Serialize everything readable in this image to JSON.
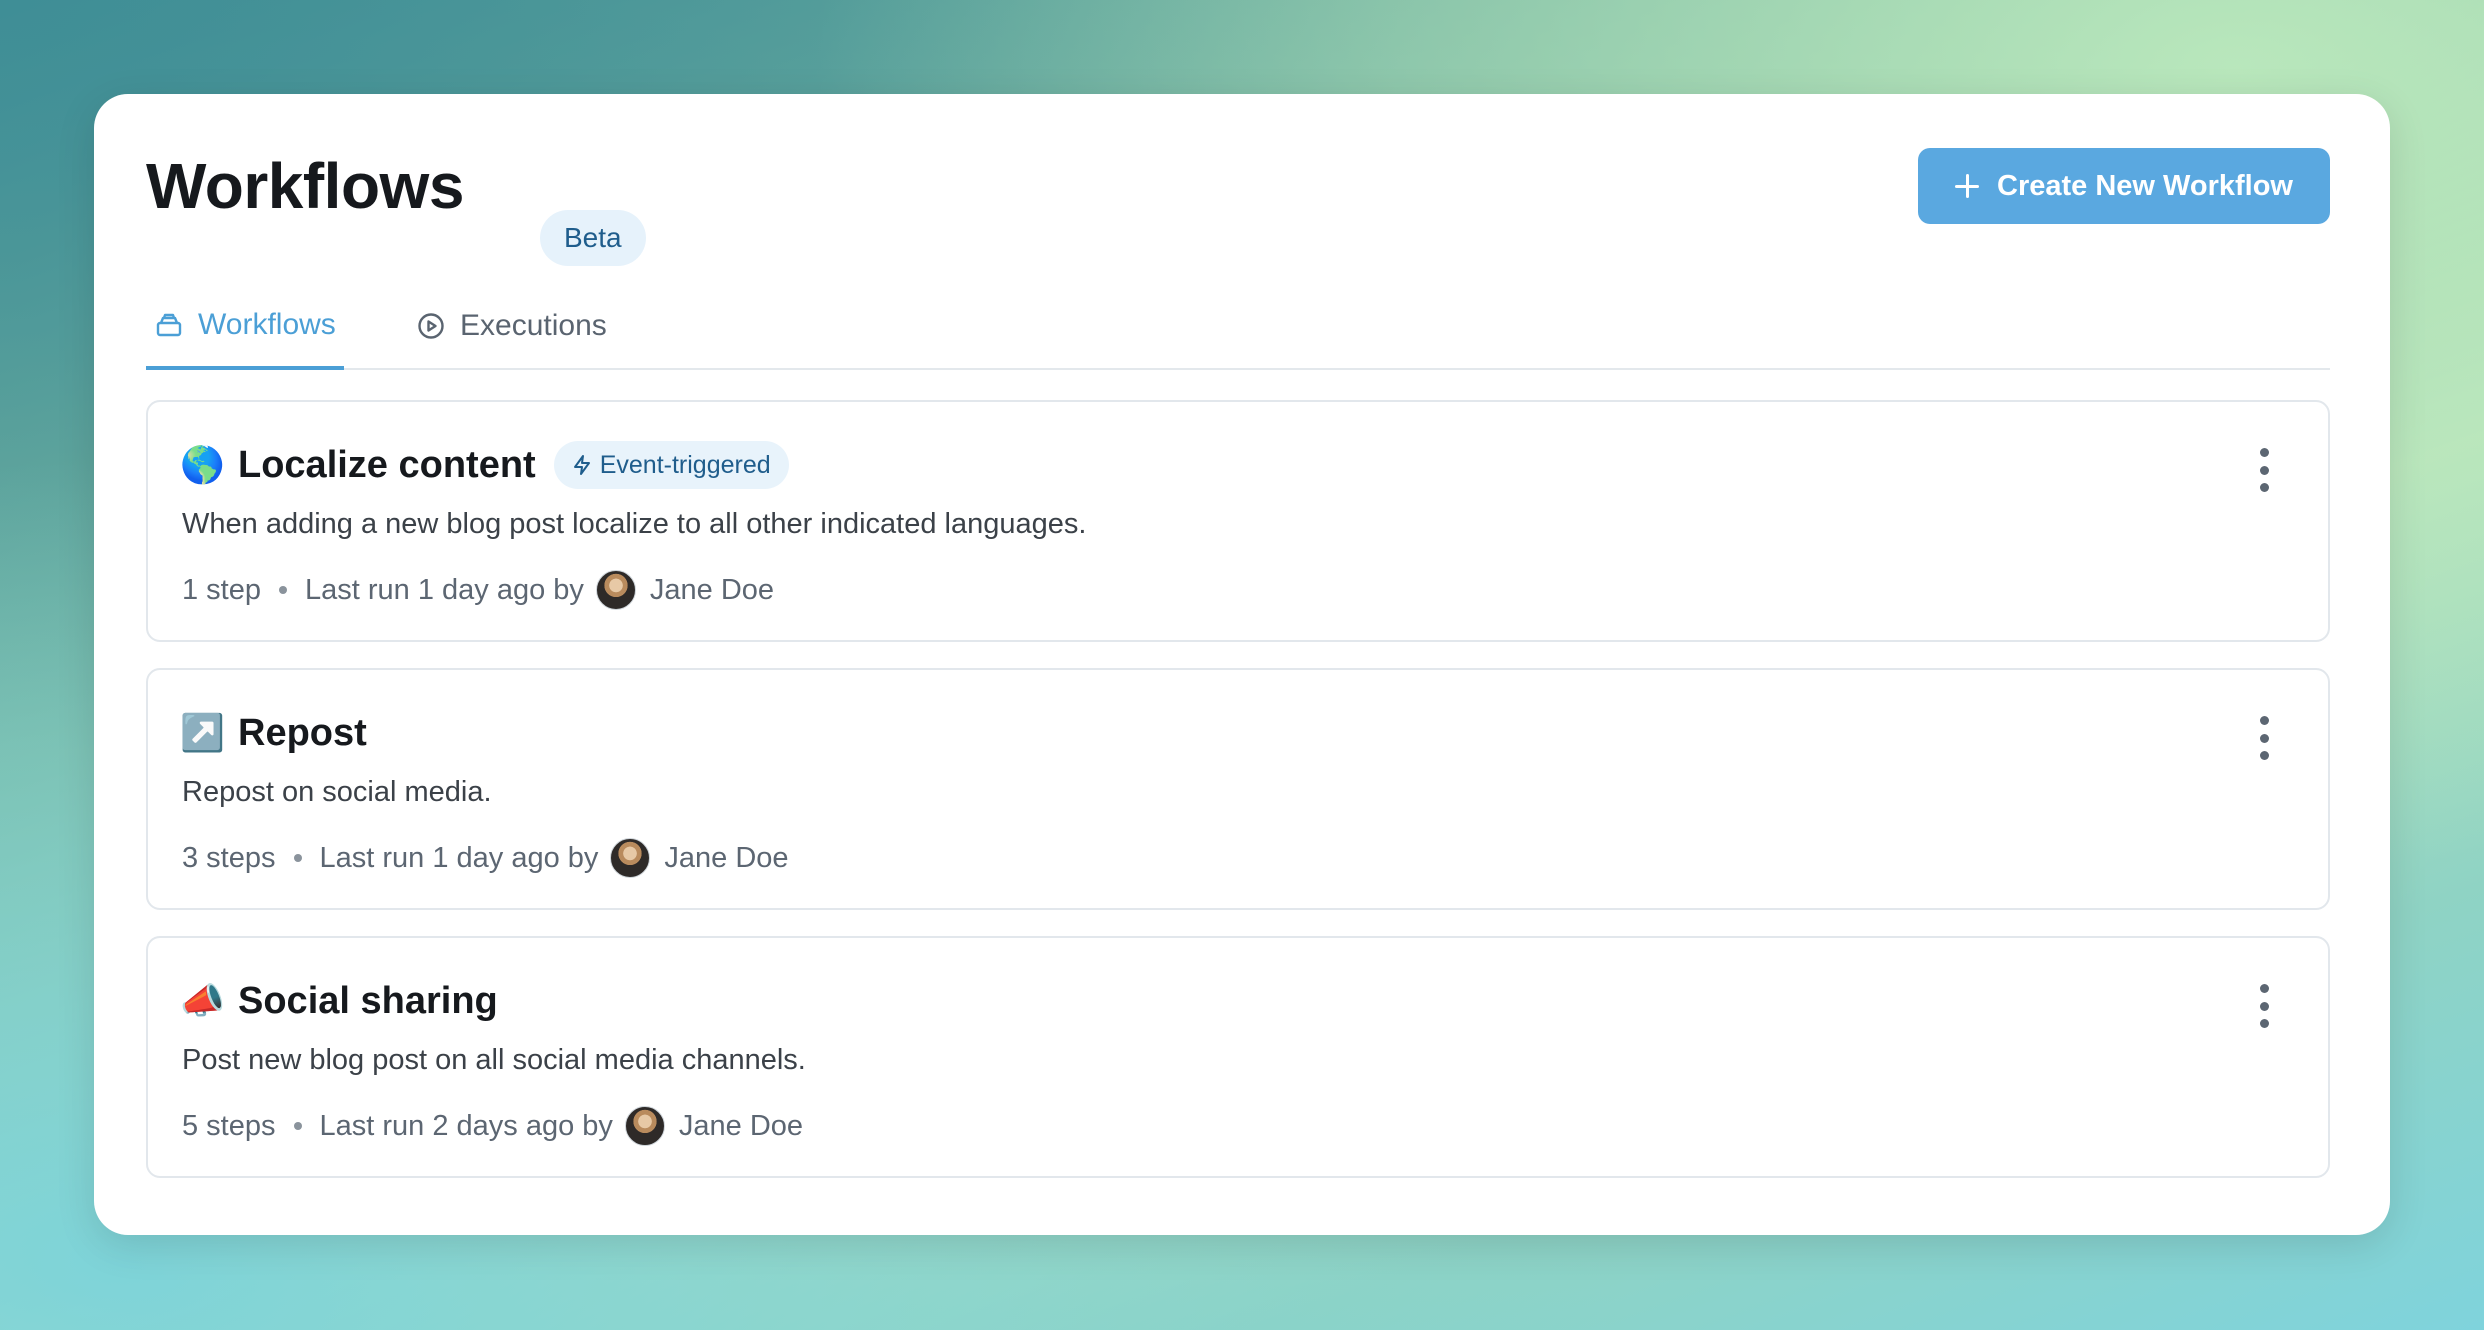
{
  "header": {
    "title": "Workflows",
    "badge": "Beta",
    "create_button_label": "Create New Workflow"
  },
  "tabs": [
    {
      "label": "Workflows",
      "icon": "stack-icon",
      "active": true
    },
    {
      "label": "Executions",
      "icon": "play-circle-icon",
      "active": false
    }
  ],
  "workflows": [
    {
      "emoji": "🌎",
      "title": "Localize content",
      "trigger_badge": "Event-triggered",
      "description": "When adding a new blog post localize to all other indicated languages.",
      "steps": "1 step",
      "last_run": "Last run 1 day ago by",
      "user": "Jane Doe"
    },
    {
      "emoji": "↗️",
      "title": "Repost",
      "description": "Repost on social media.",
      "steps": "3 steps",
      "last_run": "Last run 1 day ago by",
      "user": "Jane Doe"
    },
    {
      "emoji": "📣",
      "title": "Social sharing",
      "description": "Post new blog post on all social media channels.",
      "steps": "5 steps",
      "last_run": "Last run 2 days ago by",
      "user": "Jane Doe"
    }
  ],
  "colors": {
    "accent": "#5aa8e0",
    "badge_bg": "#e6f2fb",
    "badge_text": "#1f5d8c"
  }
}
